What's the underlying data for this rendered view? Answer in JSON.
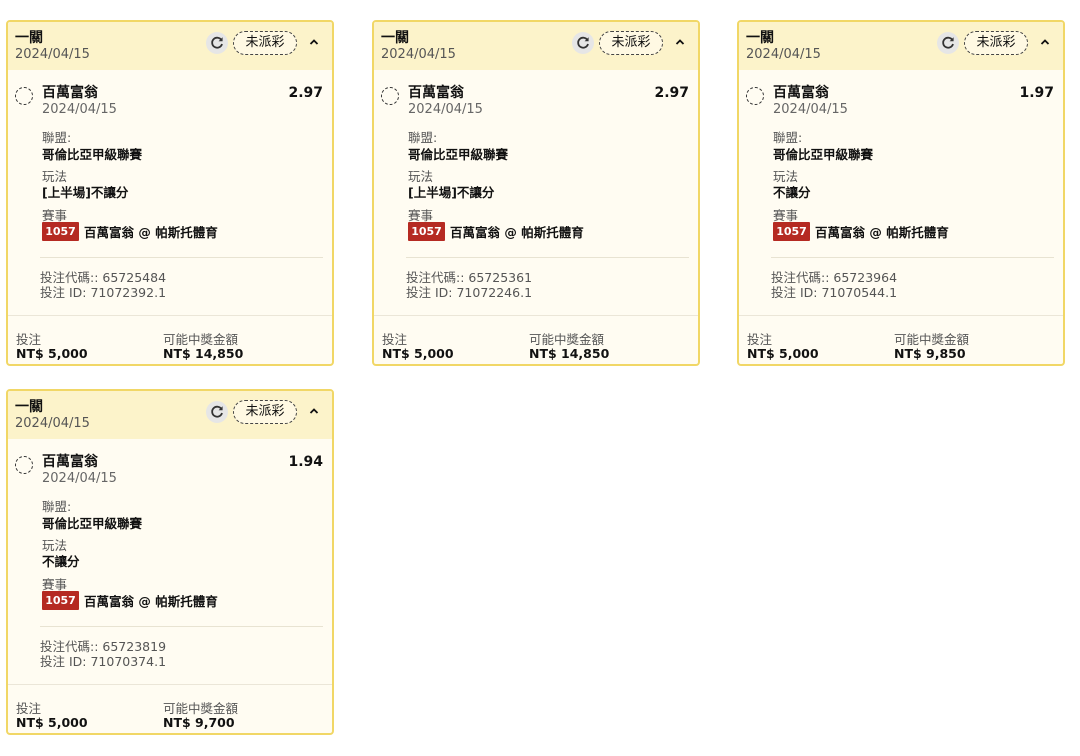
{
  "bets": [
    {
      "type": "一關",
      "date": "2024/04/15",
      "status": "未派彩",
      "selection": "百萬富翁",
      "selection_date": "2024/04/15",
      "odds": "2.97",
      "league_label": "聯盟:",
      "league": "哥倫比亞甲級聯賽",
      "market_label": "玩法",
      "market": "[上半場]不讓分",
      "event_label": "賽事",
      "match_id": "1057",
      "match_name": "百萬富翁 @ 帕斯托體育",
      "code": "投注代碼:: 65725484",
      "bet_id": "投注 ID: 71072392.1",
      "stake_label": "投注",
      "stake": "NT$ 5,000",
      "payout_label": "可能中獎金額",
      "payout": "NT$ 14,850"
    },
    {
      "type": "一關",
      "date": "2024/04/15",
      "status": "未派彩",
      "selection": "百萬富翁",
      "selection_date": "2024/04/15",
      "odds": "2.97",
      "league_label": "聯盟:",
      "league": "哥倫比亞甲級聯賽",
      "market_label": "玩法",
      "market": "[上半場]不讓分",
      "event_label": "賽事",
      "match_id": "1057",
      "match_name": "百萬富翁 @ 帕斯托體育",
      "code": "投注代碼:: 65725361",
      "bet_id": "投注 ID: 71072246.1",
      "stake_label": "投注",
      "stake": "NT$ 5,000",
      "payout_label": "可能中獎金額",
      "payout": "NT$ 14,850"
    },
    {
      "type": "一關",
      "date": "2024/04/15",
      "status": "未派彩",
      "selection": "百萬富翁",
      "selection_date": "2024/04/15",
      "odds": "1.97",
      "league_label": "聯盟:",
      "league": "哥倫比亞甲級聯賽",
      "market_label": "玩法",
      "market": "不讓分",
      "event_label": "賽事",
      "match_id": "1057",
      "match_name": "百萬富翁 @ 帕斯托體育",
      "code": "投注代碼:: 65723964",
      "bet_id": "投注 ID: 71070544.1",
      "stake_label": "投注",
      "stake": "NT$ 5,000",
      "payout_label": "可能中獎金額",
      "payout": "NT$ 9,850"
    },
    {
      "type": "一關",
      "date": "2024/04/15",
      "status": "未派彩",
      "selection": "百萬富翁",
      "selection_date": "2024/04/15",
      "odds": "1.94",
      "league_label": "聯盟:",
      "league": "哥倫比亞甲級聯賽",
      "market_label": "玩法",
      "market": "不讓分",
      "event_label": "賽事",
      "match_id": "1057",
      "match_name": "百萬富翁 @ 帕斯托體育",
      "code": "投注代碼:: 65723819",
      "bet_id": "投注 ID: 71070374.1",
      "stake_label": "投注",
      "stake": "NT$ 5,000",
      "payout_label": "可能中獎金額",
      "payout": "NT$ 9,700"
    }
  ],
  "icons": {
    "refresh": "refresh-icon",
    "collapse": "chevron-up-icon",
    "pick": "pending-circle-icon"
  },
  "colors": {
    "accent_border": "#f1d766",
    "header_bg": "#fcf3ca",
    "card_bg": "#fffcf2",
    "match_badge": "#b52a22"
  }
}
